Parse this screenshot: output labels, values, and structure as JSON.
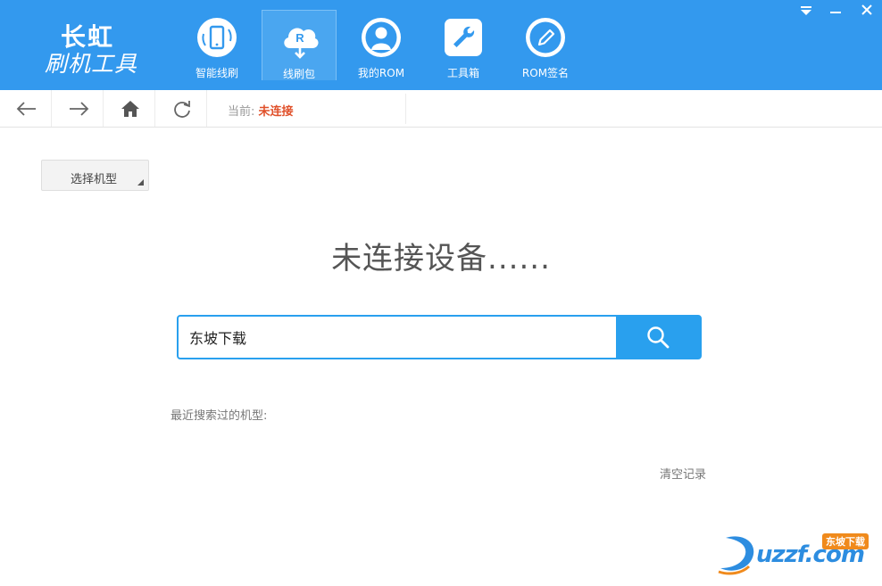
{
  "app": {
    "logo_brand": "长虹",
    "logo_subtitle": "刷机工具"
  },
  "nav": {
    "items": [
      {
        "label": "智能线刷",
        "icon": "phone-refresh-icon"
      },
      {
        "label": "线刷包",
        "icon": "cloud-download-icon",
        "active": true
      },
      {
        "label": "我的ROM",
        "icon": "user-icon"
      },
      {
        "label": "工具箱",
        "icon": "wrench-icon"
      },
      {
        "label": "ROM签名",
        "icon": "pen-icon"
      }
    ]
  },
  "window_controls": [
    "dropdown-icon",
    "minimize-icon",
    "close-icon"
  ],
  "toolbar": {
    "current_prefix": "当前:",
    "current_status": "未连接"
  },
  "main": {
    "model_select_label": "选择机型",
    "headline": "未连接设备......",
    "search_value": "东坡下载",
    "recent_label": "最近搜索过的机型:",
    "clear_label": "清空记录"
  },
  "watermark": {
    "text": "uzzf.com",
    "badge": "东坡下载"
  },
  "colors": {
    "header_bg": "#3399ee",
    "accent": "#29a0ee",
    "status_red": "#e0502a"
  }
}
